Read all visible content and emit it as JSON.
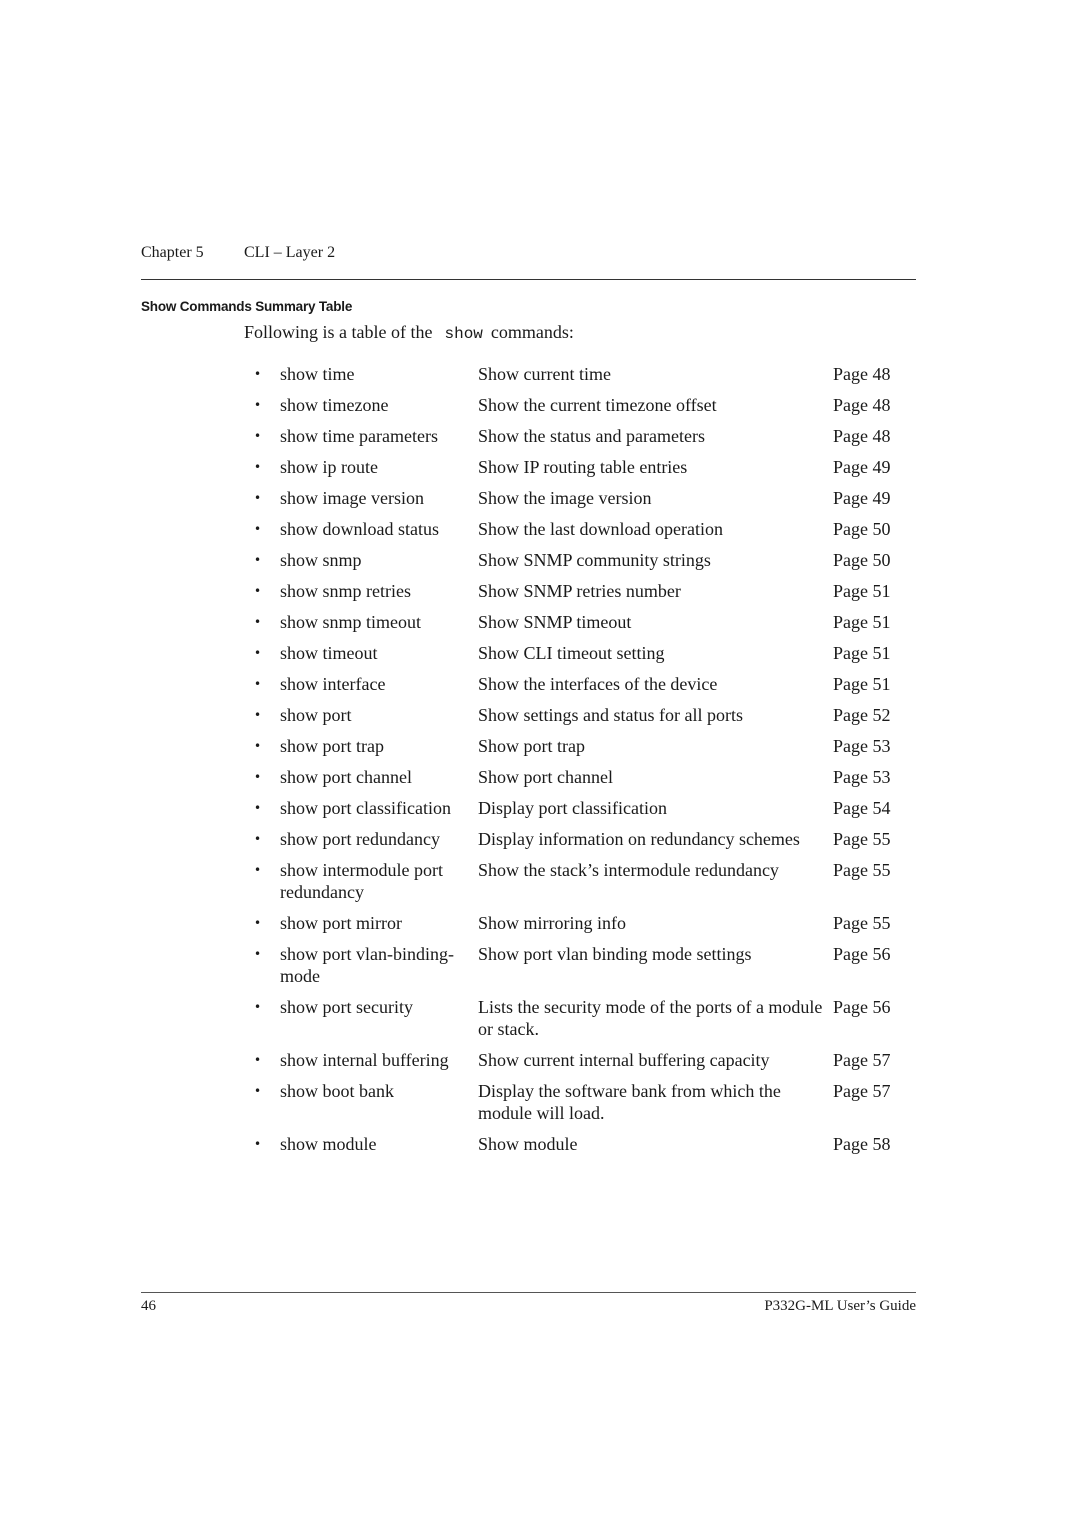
{
  "header": {
    "chapter": "Chapter 5",
    "chapter_title": "CLI – Layer 2"
  },
  "section": {
    "title": "Show Commands Summary Table",
    "intro_before": "Following is a table of the",
    "intro_code": "show",
    "intro_after": "commands:"
  },
  "commands": [
    {
      "bullet": "•",
      "command": "show time",
      "description": "Show current time",
      "page": "Page 48"
    },
    {
      "bullet": "•",
      "command": "show timezone",
      "description": "Show the current timezone offset",
      "page": "Page 48"
    },
    {
      "bullet": "•",
      "command": "show time parameters",
      "description": "Show the status and parameters",
      "page": "Page 48"
    },
    {
      "bullet": "•",
      "command": "show ip route",
      "description": "Show IP routing table entries",
      "page": "Page 49"
    },
    {
      "bullet": "•",
      "command": "show image version",
      "description": "Show the image version",
      "page": "Page 49"
    },
    {
      "bullet": "•",
      "command": "show download status",
      "description": "Show the last download operation",
      "page": "Page 50"
    },
    {
      "bullet": "•",
      "command": "show snmp",
      "description": "Show SNMP community strings",
      "page": "Page 50"
    },
    {
      "bullet": "•",
      "command": "show snmp retries",
      "description": "Show SNMP retries number",
      "page": "Page 51"
    },
    {
      "bullet": "•",
      "command": "show snmp timeout",
      "description": "Show SNMP timeout",
      "page": "Page 51"
    },
    {
      "bullet": "•",
      "command": "show timeout",
      "description": "Show CLI timeout setting",
      "page": "Page 51"
    },
    {
      "bullet": "•",
      "command": "show interface",
      "description": "Show the interfaces of the device",
      "page": "Page 51"
    },
    {
      "bullet": "•",
      "command": "show port",
      "description": "Show settings and status for all ports",
      "page": "Page 52"
    },
    {
      "bullet": "•",
      "command": "show port trap",
      "description": "Show port trap",
      "page": "Page 53"
    },
    {
      "bullet": "•",
      "command": "show port channel",
      "description": "Show port channel",
      "page": "Page 53"
    },
    {
      "bullet": "•",
      "command": "show port classification",
      "description": "Display port classification",
      "page": "Page 54"
    },
    {
      "bullet": "•",
      "command": "show port redundancy",
      "description": "Display information on redundancy schemes",
      "page": "Page 55"
    },
    {
      "bullet": "•",
      "command": "show intermodule port redundancy",
      "description": "Show the stack’s intermodule redundancy",
      "page": "Page 55"
    },
    {
      "bullet": "•",
      "command": "show port mirror",
      "description": "Show mirroring info",
      "page": "Page 55"
    },
    {
      "bullet": "•",
      "command": "show port vlan-binding-mode",
      "description": "Show port vlan binding mode settings",
      "page": "Page 56"
    },
    {
      "bullet": "•",
      "command": "show port security",
      "description": "Lists the security mode of the ports of a module or stack.",
      "page": "Page 56"
    },
    {
      "bullet": "•",
      "command": "show internal buffering",
      "description": "Show current internal buffering capacity",
      "page": "Page 57"
    },
    {
      "bullet": "•",
      "command": "show boot bank",
      "description": "Display the software bank from which the module will load.",
      "page": "Page 57"
    },
    {
      "bullet": "•",
      "command": "show module",
      "description": "Show module",
      "page": "Page 58"
    }
  ],
  "footer": {
    "page_number": "46",
    "guide_title": "P332G-ML User’s Guide"
  }
}
